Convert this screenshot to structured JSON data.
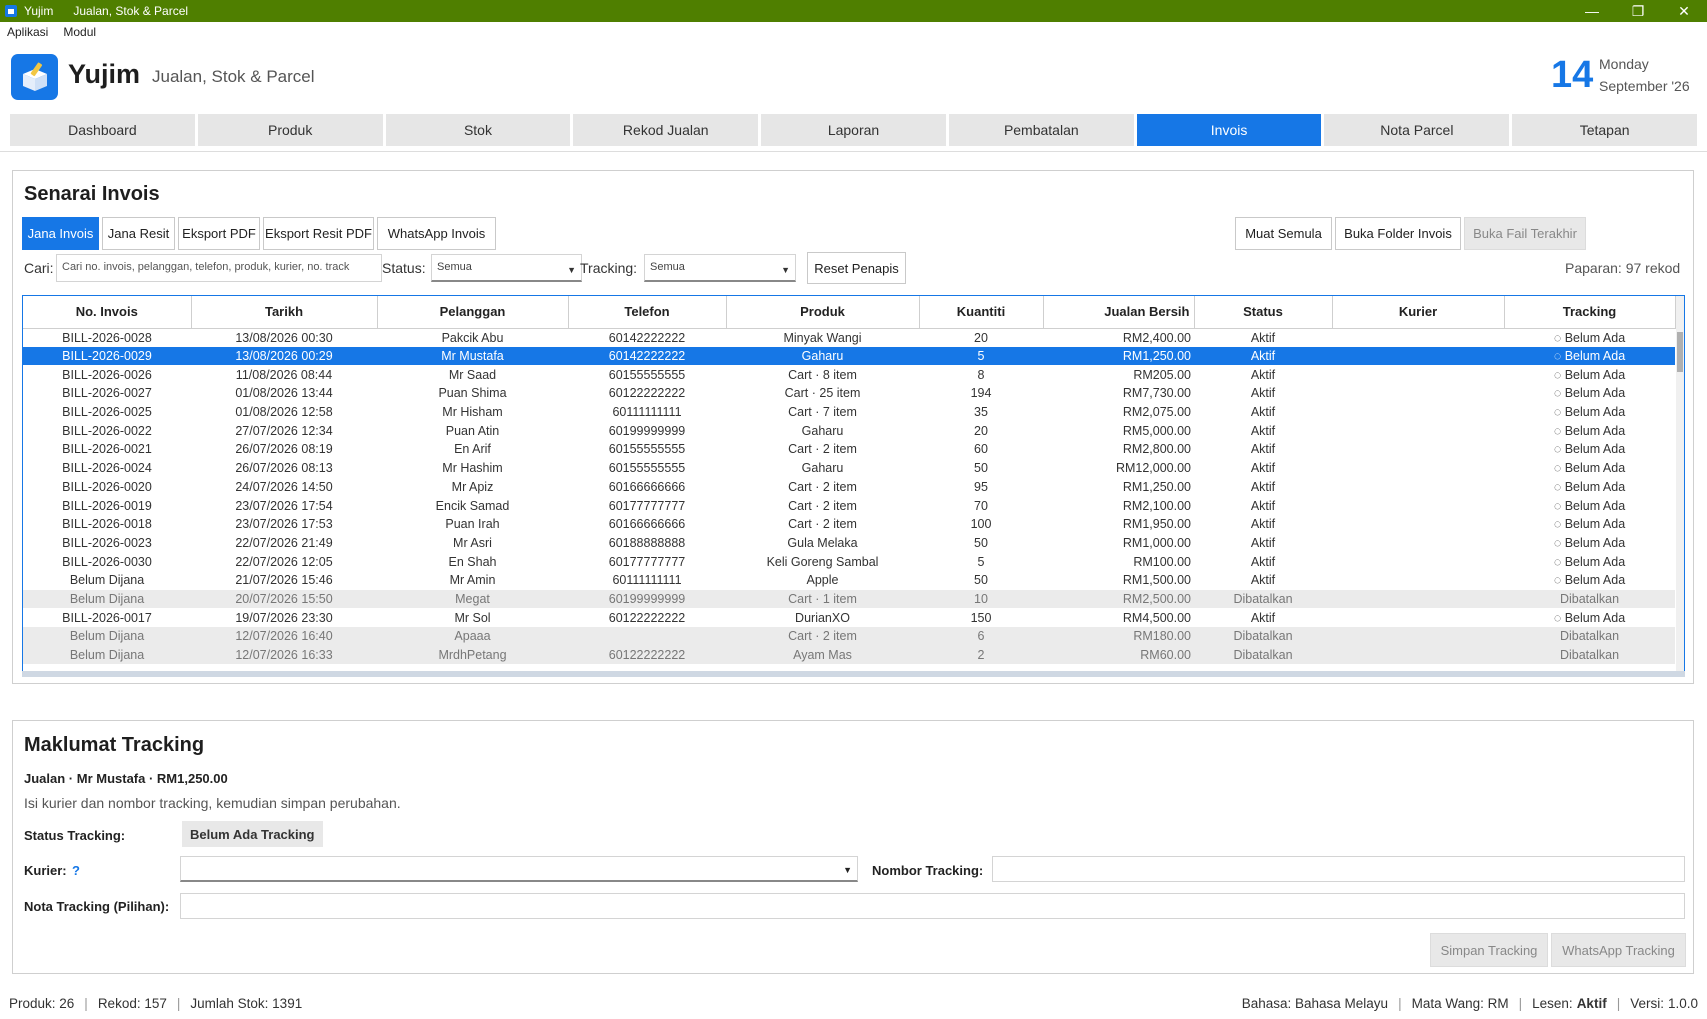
{
  "window": {
    "app": "Yujim",
    "title": "Jualan, Stok & Parcel",
    "min": "—",
    "max": "❐",
    "close": "✕"
  },
  "menu": [
    "Aplikasi",
    "Modul"
  ],
  "header": {
    "brand": "Yujim",
    "subtitle": "Jualan, Stok & Parcel",
    "day_num": "14",
    "day_name": "Monday",
    "month_year": "September '26"
  },
  "tabs": [
    "Dashboard",
    "Produk",
    "Stok",
    "Rekod Jualan",
    "Laporan",
    "Pembatalan",
    "Invois",
    "Nota Parcel",
    "Tetapan"
  ],
  "invoices": {
    "title": "Senarai Invois",
    "actions": [
      "Jana Invois",
      "Jana Resit",
      "Eksport PDF",
      "Eksport Resit PDF",
      "WhatsApp Invois"
    ],
    "right_actions": [
      "Muat Semula",
      "Buka Folder Invois",
      "Buka Fail Terakhir"
    ],
    "search_label": "Cari:",
    "search_placeholder": "Cari no. invois, pelanggan, telefon, produk, kurier, no. track",
    "status_label": "Status:",
    "status_value": "Semua",
    "tracking_label": "Tracking:",
    "tracking_value": "Semua",
    "reset_label": "Reset Penapis",
    "count_text": "Paparan: 97 rekod",
    "columns": [
      "No. Invois",
      "Tarikh",
      "Pelanggan",
      "Telefon",
      "Produk",
      "Kuantiti",
      "Jualan Bersih",
      "Status",
      "Kurier",
      "Tracking"
    ],
    "rows": [
      [
        "BILL-2026-0028",
        "13/08/2026 00:30",
        "Pakcik Abu",
        "60142222222",
        "Minyak Wangi",
        "20",
        "RM2,400.00",
        "Aktif",
        "",
        "◌ Belum Ada"
      ],
      [
        "BILL-2026-0029",
        "13/08/2026 00:29",
        "Mr Mustafa",
        "60142222222",
        "Gaharu",
        "5",
        "RM1,250.00",
        "Aktif",
        "",
        "◌ Belum Ada"
      ],
      [
        "BILL-2026-0026",
        "11/08/2026 08:44",
        "Mr Saad",
        "60155555555",
        "Cart · 8 item",
        "8",
        "RM205.00",
        "Aktif",
        "",
        "◌ Belum Ada"
      ],
      [
        "BILL-2026-0027",
        "01/08/2026 13:44",
        "Puan Shima",
        "60122222222",
        "Cart · 25 item",
        "194",
        "RM7,730.00",
        "Aktif",
        "",
        "◌ Belum Ada"
      ],
      [
        "BILL-2026-0025",
        "01/08/2026 12:58",
        "Mr Hisham",
        "60111111111",
        "Cart · 7 item",
        "35",
        "RM2,075.00",
        "Aktif",
        "",
        "◌ Belum Ada"
      ],
      [
        "BILL-2026-0022",
        "27/07/2026 12:34",
        "Puan Atin",
        "60199999999",
        "Gaharu",
        "20",
        "RM5,000.00",
        "Aktif",
        "",
        "◌ Belum Ada"
      ],
      [
        "BILL-2026-0021",
        "26/07/2026 08:19",
        "En Arif",
        "60155555555",
        "Cart · 2 item",
        "60",
        "RM2,800.00",
        "Aktif",
        "",
        "◌ Belum Ada"
      ],
      [
        "BILL-2026-0024",
        "26/07/2026 08:13",
        "Mr Hashim",
        "60155555555",
        "Gaharu",
        "50",
        "RM12,000.00",
        "Aktif",
        "",
        "◌ Belum Ada"
      ],
      [
        "BILL-2026-0020",
        "24/07/2026 14:50",
        "Mr Apiz",
        "60166666666",
        "Cart · 2 item",
        "95",
        "RM1,250.00",
        "Aktif",
        "",
        "◌ Belum Ada"
      ],
      [
        "BILL-2026-0019",
        "23/07/2026 17:54",
        "Encik Samad",
        "60177777777",
        "Cart · 2 item",
        "70",
        "RM2,100.00",
        "Aktif",
        "",
        "◌ Belum Ada"
      ],
      [
        "BILL-2026-0018",
        "23/07/2026 17:53",
        "Puan Irah",
        "60166666666",
        "Cart · 2 item",
        "100",
        "RM1,950.00",
        "Aktif",
        "",
        "◌ Belum Ada"
      ],
      [
        "BILL-2026-0023",
        "22/07/2026 21:49",
        "Mr Asri",
        "60188888888",
        "Gula Melaka",
        "50",
        "RM1,000.00",
        "Aktif",
        "",
        "◌ Belum Ada"
      ],
      [
        "BILL-2026-0030",
        "22/07/2026 12:05",
        "En Shah",
        "60177777777",
        "Keli Goreng Sambal",
        "5",
        "RM100.00",
        "Aktif",
        "",
        "◌ Belum Ada"
      ],
      [
        "Belum Dijana",
        "21/07/2026 15:46",
        "Mr Amin",
        "60111111111",
        "Apple",
        "50",
        "RM1,500.00",
        "Aktif",
        "",
        "◌ Belum Ada"
      ],
      [
        "Belum Dijana",
        "20/07/2026 15:50",
        "Megat",
        "60199999999",
        "Cart · 1 item",
        "10",
        "RM2,500.00",
        "Dibatalkan",
        "",
        "Dibatalkan"
      ],
      [
        "BILL-2026-0017",
        "19/07/2026 23:30",
        "Mr Sol",
        "60122222222",
        "DurianXO",
        "150",
        "RM4,500.00",
        "Aktif",
        "",
        "◌ Belum Ada"
      ],
      [
        "Belum Dijana",
        "12/07/2026 16:40",
        "Apaaa",
        "",
        "Cart · 2 item",
        "6",
        "RM180.00",
        "Dibatalkan",
        "",
        "Dibatalkan"
      ],
      [
        "Belum Dijana",
        "12/07/2026 16:33",
        "MrdhPetang",
        "60122222222",
        "Ayam Mas",
        "2",
        "RM60.00",
        "Dibatalkan",
        "",
        "Dibatalkan"
      ]
    ],
    "selected_row": 1
  },
  "tracking": {
    "title": "Maklumat Tracking",
    "sale_line": "Jualan · Mr Mustafa · RM1,250.00",
    "hint": "Isi kurier dan nombor tracking, kemudian simpan perubahan.",
    "status_label": "Status Tracking:",
    "status_value": "Belum Ada Tracking",
    "courier_label": "Kurier:",
    "courier_help": "?",
    "number_label": "Nombor Tracking:",
    "note_label": "Nota Tracking (Pilihan):",
    "save_label": "Simpan Tracking",
    "whatsapp_label": "WhatsApp Tracking"
  },
  "statusbar": {
    "produk": "Produk: 26",
    "rekod": "Rekod: 157",
    "stok": "Jumlah Stok: 1391",
    "bahasa": "Bahasa: Bahasa Melayu",
    "matawang": "Mata Wang: RM",
    "lesen_label": "Lesen:",
    "lesen_value": "Aktif",
    "versi_label": "Versi:",
    "versi_value": "1.0.0"
  },
  "colors": {
    "titlebar": "#4f7f00",
    "accent": "#1677e6"
  }
}
